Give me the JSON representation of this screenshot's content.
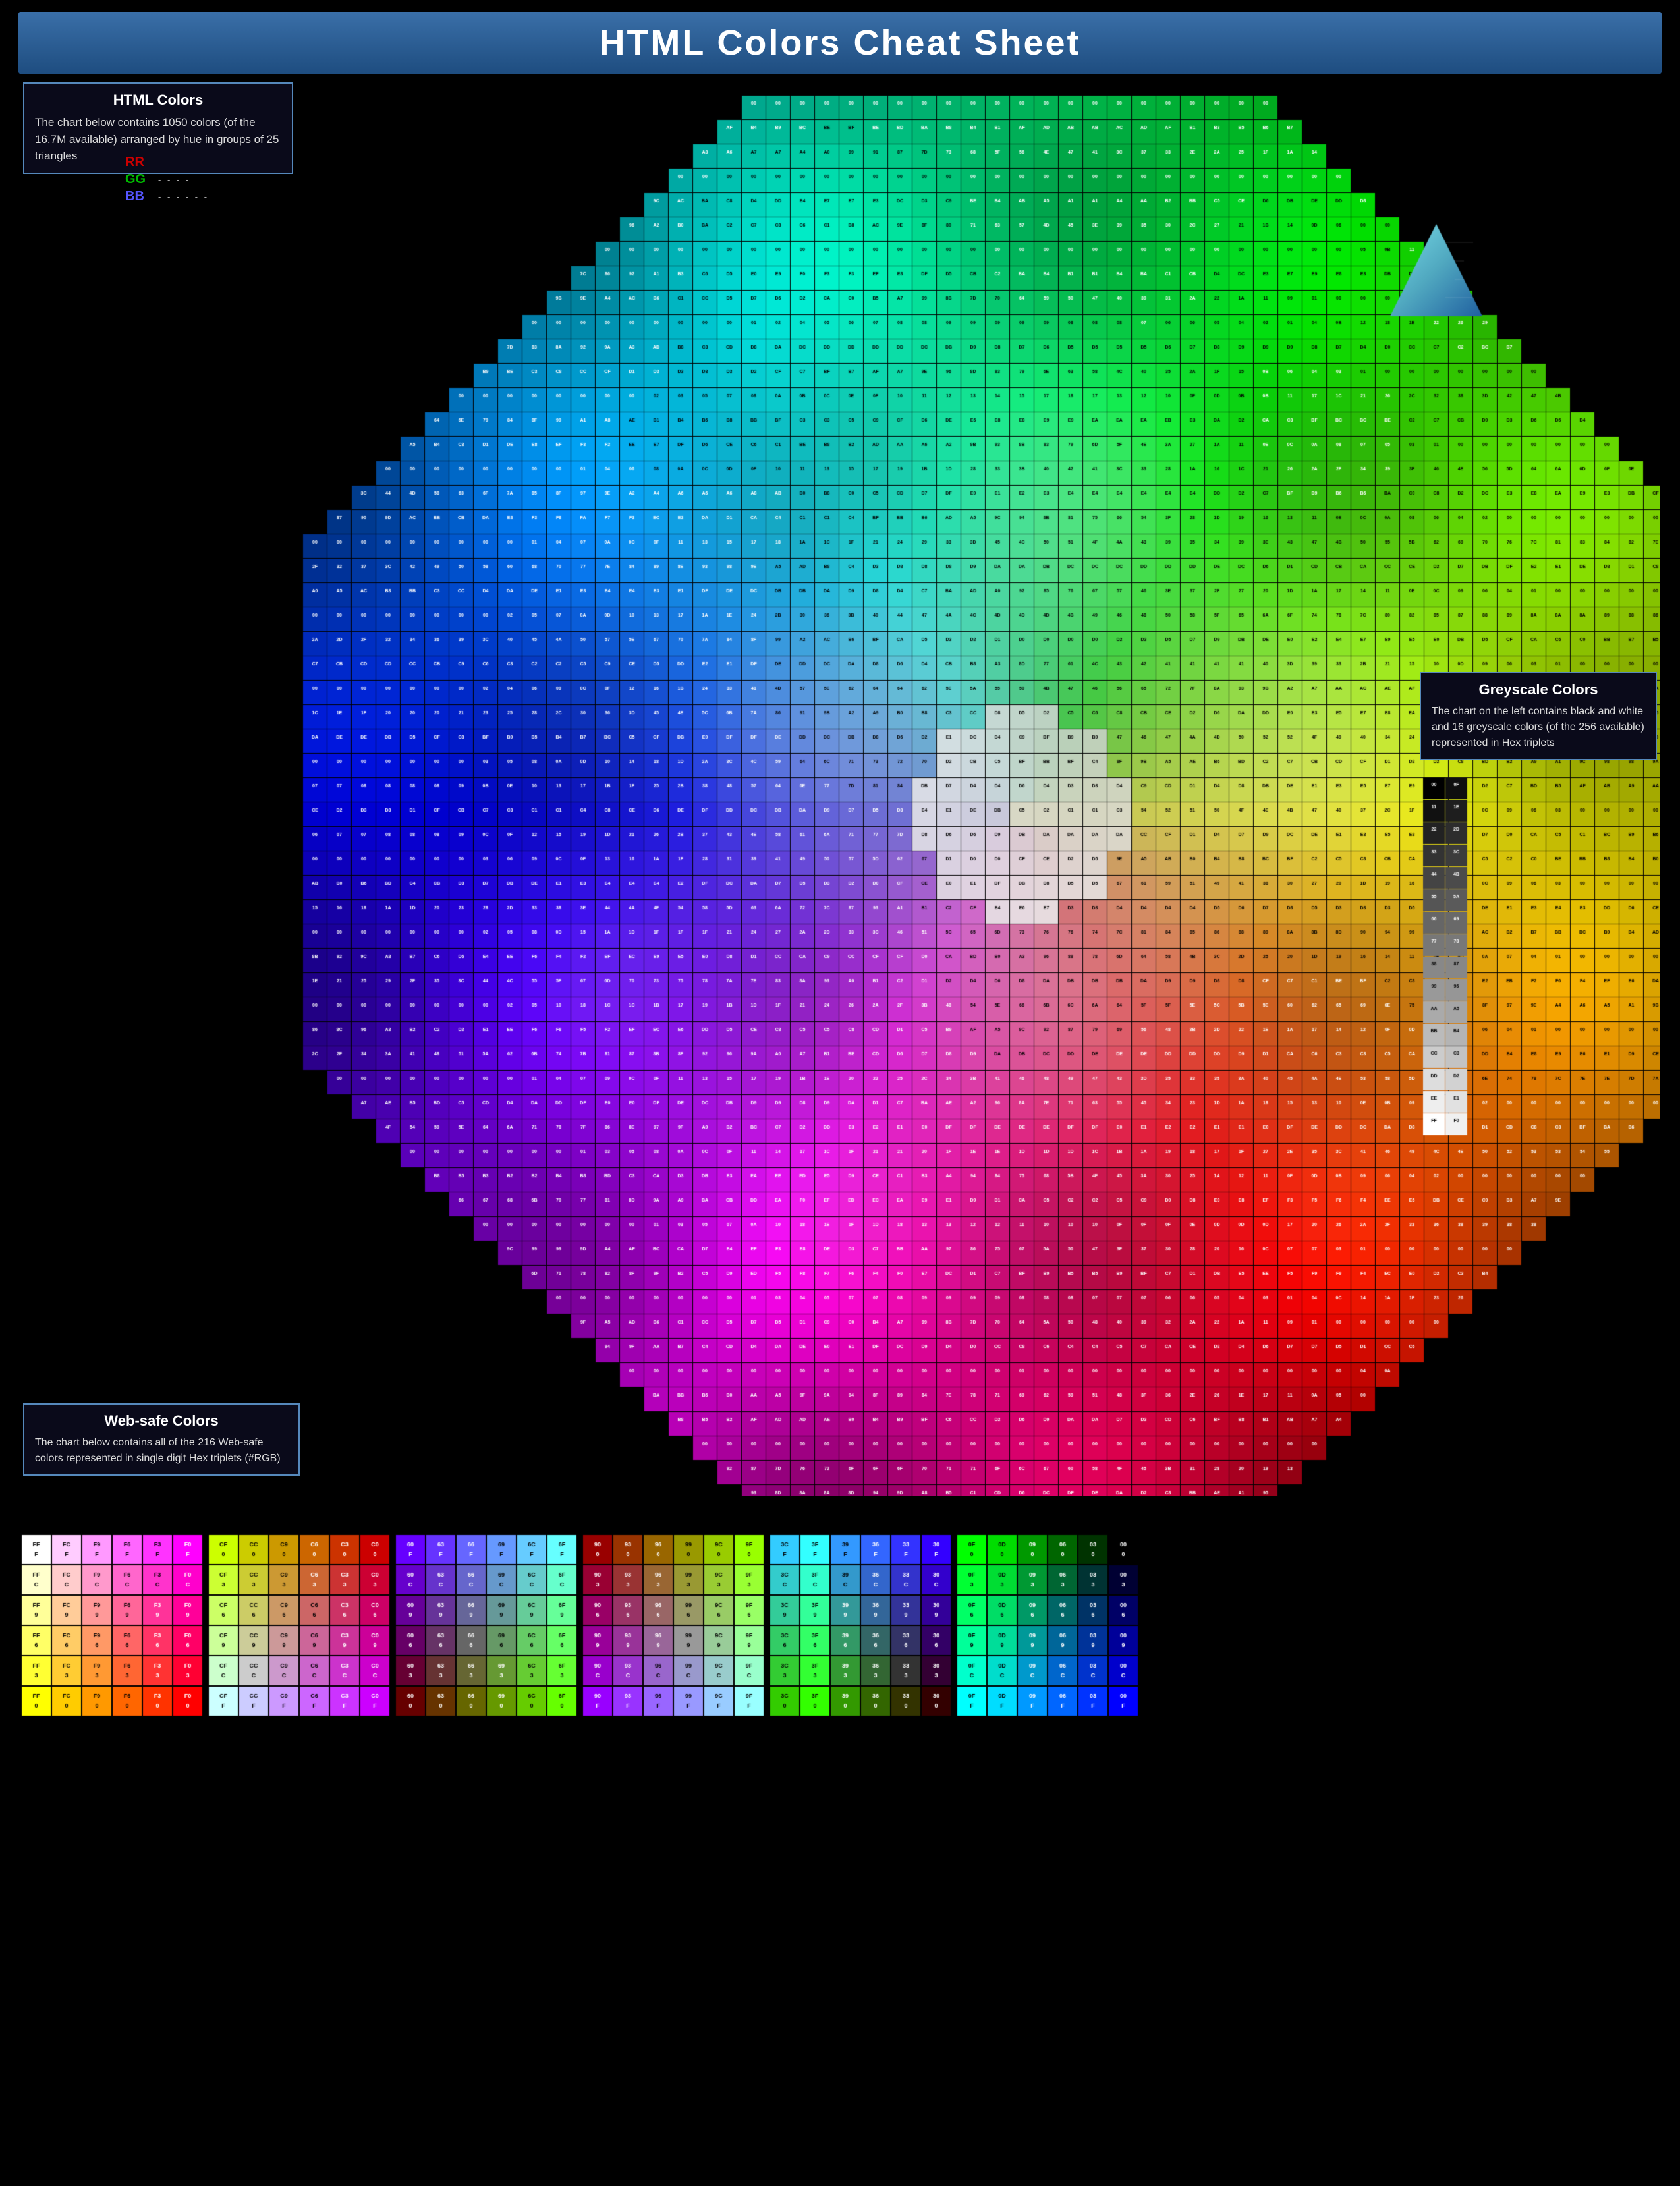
{
  "title": "HTML Colors Cheat Sheet",
  "html_colors_box": {
    "heading": "HTML Colors",
    "description": "The chart below contains 1050 colors (of the 16.7M available) arranged by hue in groups of 25 triangles"
  },
  "legend": {
    "rr": "RR",
    "gg": "GG",
    "bb": "BB"
  },
  "websafe_box": {
    "heading": "Web-safe Colors",
    "description": "The chart below contains all of the 216 Web-safe colors represented in single digit Hex triplets (#RGB)"
  },
  "greyscale_box": {
    "heading": "Greyscale Colors",
    "description": "The chart on the left contains black and white and 16 greyscale colors (of the 256 available) represented in Hex triplets"
  },
  "bottom_row_labels": [
    "FFF",
    "FCF",
    "F9F",
    "F6F",
    "F3F",
    "F0F",
    "CF0",
    "CC0",
    "C90",
    "C60",
    "C30",
    "C00",
    "60F",
    "63F",
    "66F",
    "69F",
    "6CF",
    "6FF",
    "900",
    "930",
    "960",
    "990",
    "9C0",
    "9F0",
    "3CF",
    "3FF",
    "39F",
    "36F",
    "33F",
    "30F",
    "0F0",
    "0D0",
    "090",
    "060",
    "030",
    "000"
  ],
  "colors": {
    "accent_blue": "#3a6fa8"
  }
}
